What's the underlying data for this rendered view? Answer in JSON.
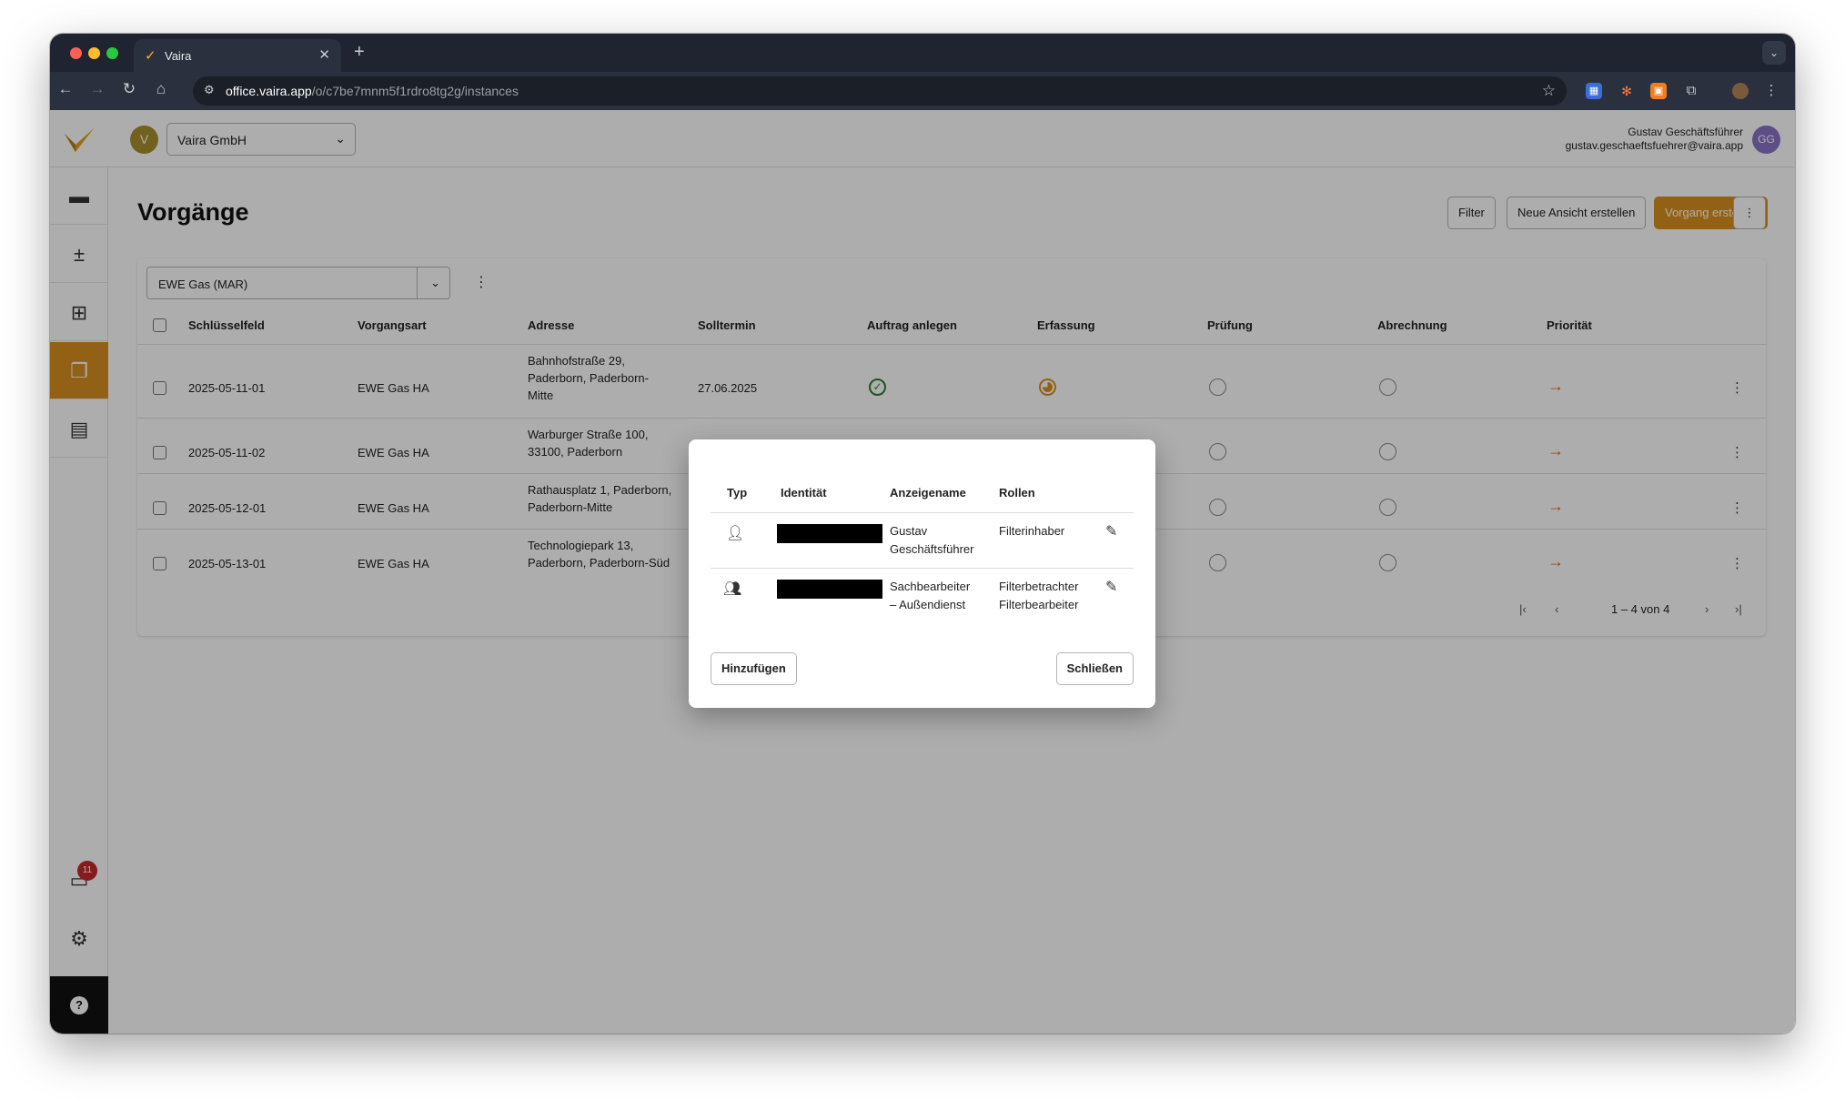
{
  "browser": {
    "tab_title": "Vaira",
    "url_host": "office.vaira.app",
    "url_path": "/o/c7be7mnm5f1rdro8tg2g/instances"
  },
  "header": {
    "org_initial": "V",
    "org_name": "Vaira GmbH",
    "user_name": "Gustav Geschäftsführer",
    "user_email": "gustav.geschaeftsfuehrer@vaira.app",
    "user_initials": "GG"
  },
  "sidebar": {
    "inbox_badge": "11"
  },
  "page": {
    "title": "Vorgänge",
    "filter_label": "Filter",
    "new_view_label": "Neue Ansicht erstellen",
    "create_label": "Vorgang erstellen"
  },
  "view": {
    "selected": "EWE Gas (MAR)"
  },
  "table": {
    "columns": [
      "Schlüsselfeld",
      "Vorgangsart",
      "Adresse",
      "Solltermin",
      "Auftrag anlegen",
      "Erfassung",
      "Prüfung",
      "Abrechnung",
      "Priorität"
    ],
    "rows": [
      {
        "key": "2025-05-11-01",
        "type": "EWE Gas HA",
        "address_lines": [
          "Bahnhofstraße 29,",
          "Paderborn, Paderborn-",
          "Mitte"
        ],
        "due": "27.06.2025"
      },
      {
        "key": "2025-05-11-02",
        "type": "EWE Gas HA",
        "address_lines": [
          "Warburger Straße 100,",
          "33100, Paderborn"
        ],
        "due": ""
      },
      {
        "key": "2025-05-12-01",
        "type": "EWE Gas HA",
        "address_lines": [
          "Rathausplatz 1, Paderborn,",
          "Paderborn-Mitte"
        ],
        "due": ""
      },
      {
        "key": "2025-05-13-01",
        "type": "EWE Gas HA",
        "address_lines": [
          "Technologiepark 13,",
          "Paderborn, Paderborn-Süd"
        ],
        "due": ""
      }
    ],
    "pagination": "1 – 4 von 4"
  },
  "dialog": {
    "columns": [
      "Typ",
      "Identität",
      "Anzeigename",
      "Rollen"
    ],
    "rows": [
      {
        "icon": "person-icon",
        "display_lines": [
          "Gustav",
          "Geschäftsführer"
        ],
        "role_lines": [
          "Filterinhaber"
        ]
      },
      {
        "icon": "group-icon",
        "display_lines": [
          "Sachbearbeiter",
          "– Außendienst"
        ],
        "role_lines": [
          "Filterbetrachter",
          "Filterbearbeiter"
        ]
      }
    ],
    "add_label": "Hinzufügen",
    "close_label": "Schließen"
  },
  "colors": {
    "accent": "#d9901f",
    "done": "#2e7d32",
    "priority": "#d9651f",
    "badge": "#c62828"
  }
}
